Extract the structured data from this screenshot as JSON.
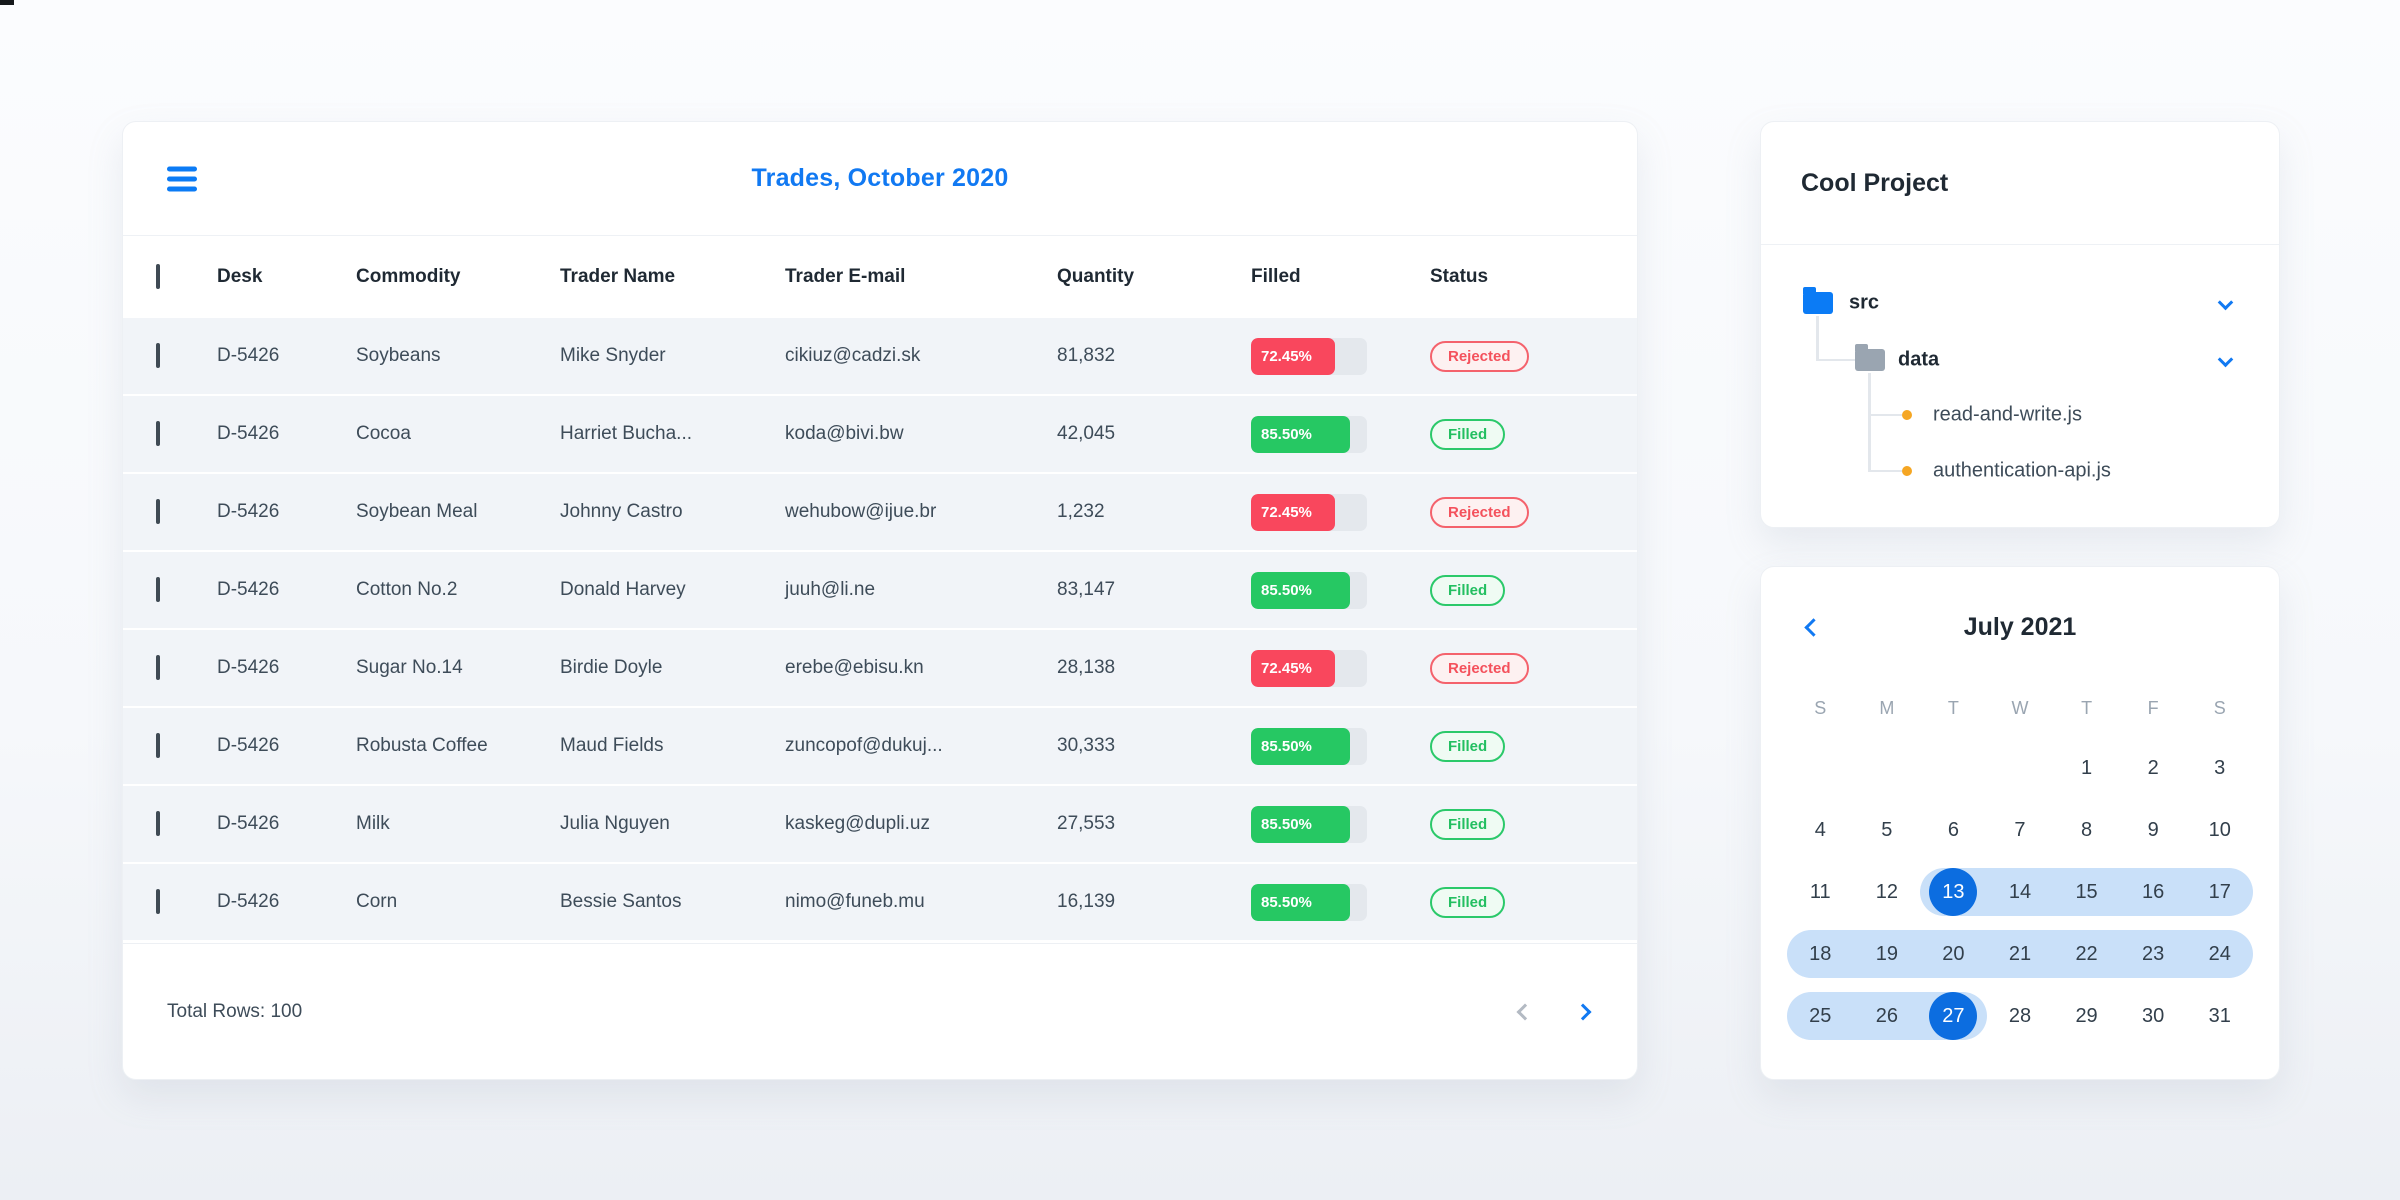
{
  "colors": {
    "accent_blue": "#1179f2",
    "progress_red": "#f9475d",
    "progress_green": "#26c863",
    "badge_rejected": "#f4515c",
    "badge_filled": "#23bf61",
    "calendar_selected": "#0c6de0",
    "calendar_range": "#c9e0f9",
    "folder_blue": "#0b7bf5",
    "folder_gray": "#9aa5b1",
    "file_dot_orange": "#f5a623"
  },
  "trades_card": {
    "title": "Trades, October 2020",
    "columns": [
      "Desk",
      "Commodity",
      "Trader Name",
      "Trader E-mail",
      "Quantity",
      "Filled",
      "Status"
    ],
    "rows": [
      {
        "desk": "D-5426",
        "commodity": "Soybeans",
        "trader": "Mike Snyder",
        "email": "cikiuz@cadzi.sk",
        "quantity": "81,832",
        "filled_label": "72.45%",
        "filled_value": 72.45,
        "filled_color": "red",
        "status": "Rejected",
        "status_type": "rejected"
      },
      {
        "desk": "D-5426",
        "commodity": "Cocoa",
        "trader": "Harriet Bucha...",
        "email": "koda@bivi.bw",
        "quantity": "42,045",
        "filled_label": "85.50%",
        "filled_value": 85.5,
        "filled_color": "green",
        "status": "Filled",
        "status_type": "filled"
      },
      {
        "desk": "D-5426",
        "commodity": "Soybean Meal",
        "trader": "Johnny Castro",
        "email": "wehubow@ijue.br",
        "quantity": "1,232",
        "filled_label": "72.45%",
        "filled_value": 72.45,
        "filled_color": "red",
        "status": "Rejected",
        "status_type": "rejected"
      },
      {
        "desk": "D-5426",
        "commodity": "Cotton No.2",
        "trader": "Donald Harvey",
        "email": "juuh@li.ne",
        "quantity": "83,147",
        "filled_label": "85.50%",
        "filled_value": 85.5,
        "filled_color": "green",
        "status": "Filled",
        "status_type": "filled"
      },
      {
        "desk": "D-5426",
        "commodity": "Sugar No.14",
        "trader": "Birdie Doyle",
        "email": "erebe@ebisu.kn",
        "quantity": "28,138",
        "filled_label": "72.45%",
        "filled_value": 72.45,
        "filled_color": "red",
        "status": "Rejected",
        "status_type": "rejected"
      },
      {
        "desk": "D-5426",
        "commodity": "Robusta Coffee",
        "trader": "Maud Fields",
        "email": "zuncopof@dukuj...",
        "quantity": "30,333",
        "filled_label": "85.50%",
        "filled_value": 85.5,
        "filled_color": "green",
        "status": "Filled",
        "status_type": "filled"
      },
      {
        "desk": "D-5426",
        "commodity": "Milk",
        "trader": "Julia Nguyen",
        "email": "kaskeg@dupli.uz",
        "quantity": "27,553",
        "filled_label": "85.50%",
        "filled_value": 85.5,
        "filled_color": "green",
        "status": "Filled",
        "status_type": "filled"
      },
      {
        "desk": "D-5426",
        "commodity": "Corn",
        "trader": "Bessie Santos",
        "email": "nimo@funeb.mu",
        "quantity": "16,139",
        "filled_label": "85.50%",
        "filled_value": 85.5,
        "filled_color": "green",
        "status": "Filled",
        "status_type": "filled"
      }
    ],
    "footer": {
      "total_label": "Total Rows: 100"
    }
  },
  "project_card": {
    "title": "Cool Project",
    "tree": {
      "root_label": "src",
      "child_label": "data",
      "files": [
        "read-and-write.js",
        "authentication-api.js"
      ]
    }
  },
  "calendar_card": {
    "title": "July 2021",
    "weekdays": [
      "S",
      "M",
      "T",
      "W",
      "T",
      "F",
      "S"
    ],
    "weeks": [
      [
        {
          "label": ""
        },
        {
          "label": ""
        },
        {
          "label": ""
        },
        {
          "label": ""
        },
        {
          "label": "1"
        },
        {
          "label": "2"
        },
        {
          "label": "3"
        }
      ],
      [
        {
          "label": "4"
        },
        {
          "label": "5"
        },
        {
          "label": "6"
        },
        {
          "label": "7"
        },
        {
          "label": "8"
        },
        {
          "label": "9"
        },
        {
          "label": "10"
        }
      ],
      [
        {
          "label": "11"
        },
        {
          "label": "12"
        },
        {
          "label": "13",
          "in_range": true,
          "cap_left": true,
          "selected": true
        },
        {
          "label": "14",
          "in_range": true
        },
        {
          "label": "15",
          "in_range": true
        },
        {
          "label": "16",
          "in_range": true
        },
        {
          "label": "17",
          "in_range": true,
          "cap_right": true
        }
      ],
      [
        {
          "label": "18",
          "in_range": true,
          "cap_left": true
        },
        {
          "label": "19",
          "in_range": true
        },
        {
          "label": "20",
          "in_range": true
        },
        {
          "label": "21",
          "in_range": true
        },
        {
          "label": "22",
          "in_range": true
        },
        {
          "label": "23",
          "in_range": true
        },
        {
          "label": "24",
          "in_range": true,
          "cap_right": true
        }
      ],
      [
        {
          "label": "25",
          "in_range": true,
          "cap_left": true
        },
        {
          "label": "26",
          "in_range": true
        },
        {
          "label": "27",
          "in_range": true,
          "cap_right": true,
          "selected": true
        },
        {
          "label": "28"
        },
        {
          "label": "29"
        },
        {
          "label": "30"
        },
        {
          "label": "31"
        }
      ]
    ]
  }
}
